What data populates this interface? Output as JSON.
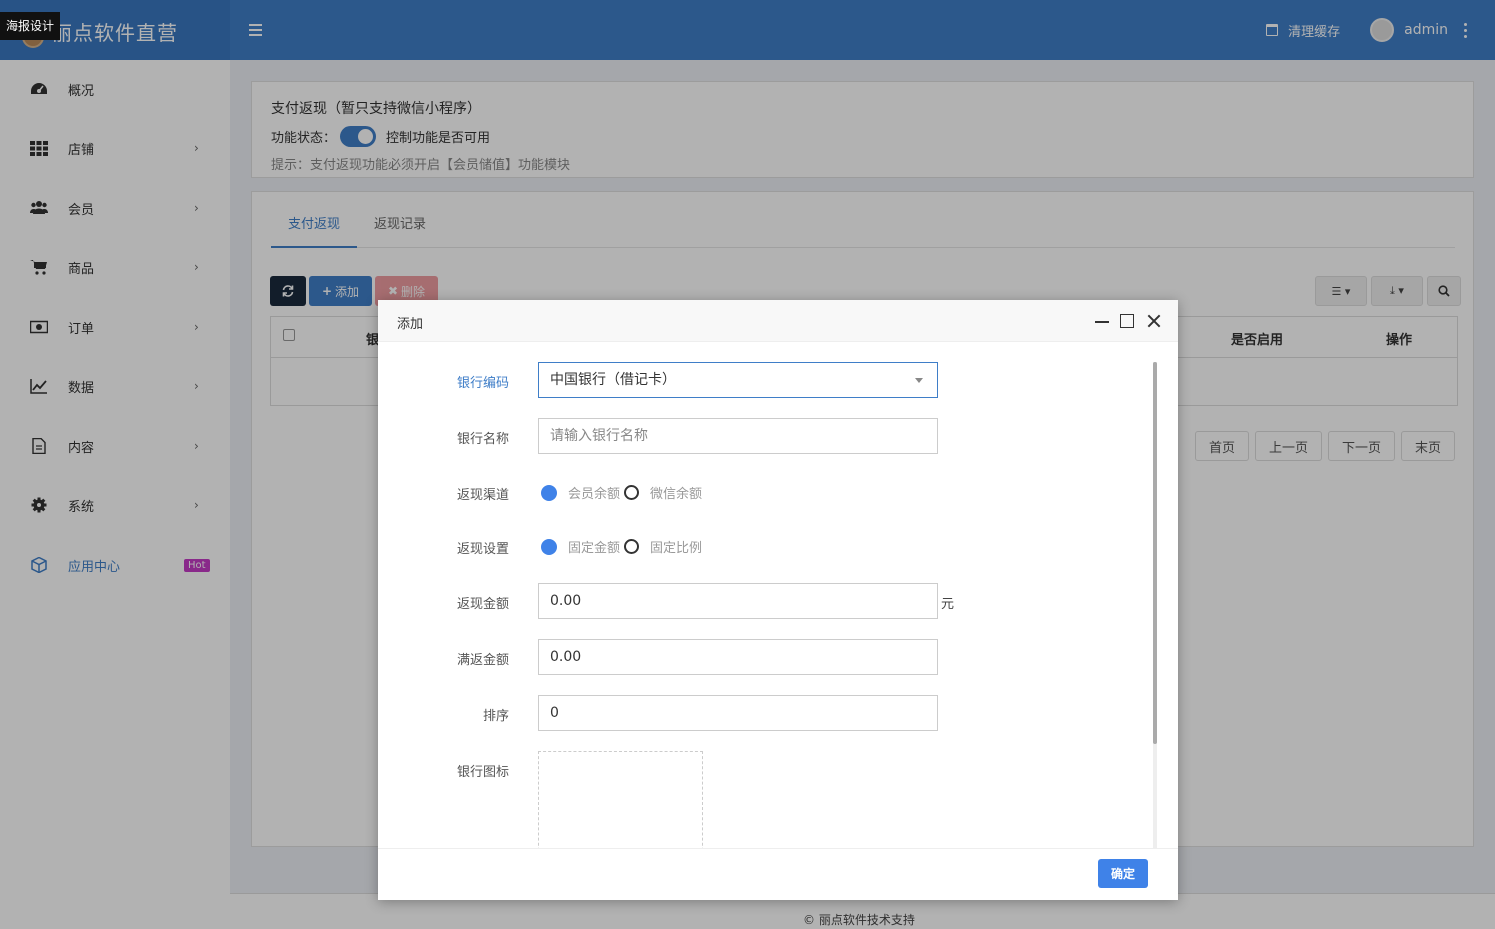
{
  "header": {
    "brand_title": "丽点软件直营",
    "tooltip": "海报设计",
    "clear_cache": "清理缓存",
    "username": "admin"
  },
  "sidebar": {
    "items": [
      {
        "label": "概况",
        "icon": "dashboard-icon",
        "chevron": ""
      },
      {
        "label": "店铺",
        "icon": "grid-icon",
        "chevron": "›"
      },
      {
        "label": "会员",
        "icon": "users-icon",
        "chevron": "›"
      },
      {
        "label": "商品",
        "icon": "cart-icon",
        "chevron": "›"
      },
      {
        "label": "订单",
        "icon": "money-icon",
        "chevron": "›"
      },
      {
        "label": "数据",
        "icon": "chart-icon",
        "chevron": "›"
      },
      {
        "label": "内容",
        "icon": "document-icon",
        "chevron": "›"
      },
      {
        "label": "系统",
        "icon": "gear-icon",
        "chevron": "›"
      },
      {
        "label": "应用中心",
        "icon": "cube-icon",
        "badge": "Hot"
      }
    ]
  },
  "panel": {
    "title": "支付返现（暂只支持微信小程序）",
    "status_label": "功能状态：",
    "status_desc": "控制功能是否可用",
    "hint": "提示：支付返现功能必须开启【会员储值】功能模块"
  },
  "tabs": [
    "支付返现",
    "返现记录"
  ],
  "toolbar": {
    "add": "添加",
    "delete": "删除"
  },
  "table": {
    "headers": [
      "银",
      "是否启用",
      "操作"
    ]
  },
  "pager": [
    "首页",
    "上一页",
    "下一页",
    "末页"
  ],
  "footer": "© 丽点软件技术支持",
  "modal": {
    "title": "添加",
    "fields": {
      "bank_code_label": "银行编码",
      "bank_code_value": "中国银行（借记卡）",
      "bank_name_label": "银行名称",
      "bank_name_placeholder": "请输入银行名称",
      "channel_label": "返现渠道",
      "channel_options": [
        "会员余额",
        "微信余额"
      ],
      "setting_label": "返现设置",
      "setting_options": [
        "固定金额",
        "固定比例"
      ],
      "amount_label": "返现金额",
      "amount_value": "0.00",
      "amount_unit": "元",
      "threshold_label": "满返金额",
      "threshold_value": "0.00",
      "sort_label": "排序",
      "sort_value": "0",
      "icon_label": "银行图标"
    },
    "confirm": "确定"
  },
  "colors": {
    "primary": "#3f7ec8",
    "radio_checked": "#3f82e8",
    "hot_badge": "#c43bc6"
  }
}
